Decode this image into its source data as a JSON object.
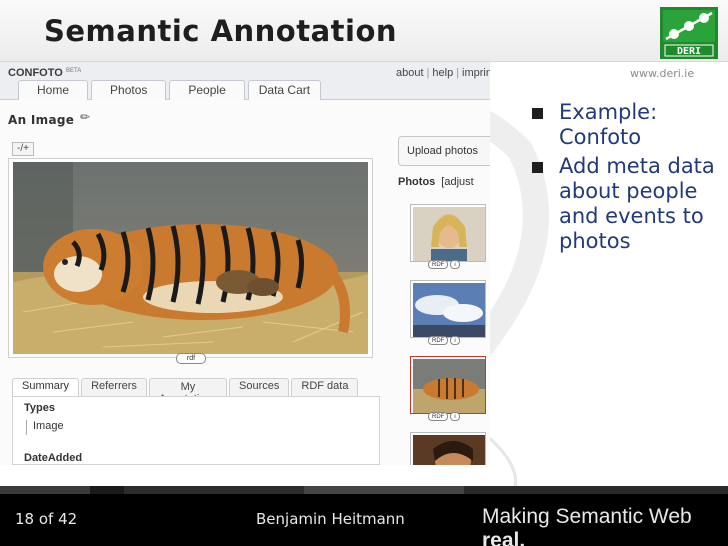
{
  "slide": {
    "title": "Semantic Annotation",
    "url": "www.deri.ie",
    "logo_text": "DERI"
  },
  "screenshot": {
    "brand": "CONFOTO",
    "brand_sup": "BETA",
    "top_links": [
      "about",
      "help",
      "imprint"
    ],
    "nav_tabs": [
      "Home",
      "Photos",
      "People",
      "Data Cart"
    ],
    "section_title": "An Image",
    "zoom_label": "-/+",
    "rdf_badge": "rdf",
    "upload_label": "Upload photos",
    "photos_label": "Photos",
    "photos_link": "[adjust",
    "info_tabs": [
      "Summary",
      "Referrers",
      "My Annotations",
      "Sources",
      "RDF data"
    ],
    "info_tab_my_top": "My",
    "info_tab_my_bottom": "Annotations",
    "types_label": "Types",
    "types_value": "Image",
    "date_label": "DateAdded",
    "thumb_badge_rdf": "RDF",
    "thumb_badge_i": "i"
  },
  "bullets": [
    "Example: Confoto",
    "Add meta data about people and events to photos"
  ],
  "footer": {
    "slide_number": "18 of 42",
    "author": "Benjamin Heitmann",
    "tagline_prefix": "Making Semantic Web ",
    "tagline_bold": "real."
  },
  "colors": {
    "bullet_text": "#223a7a",
    "logo_green": "#1f8a2c",
    "footer_bg": "#000000"
  }
}
